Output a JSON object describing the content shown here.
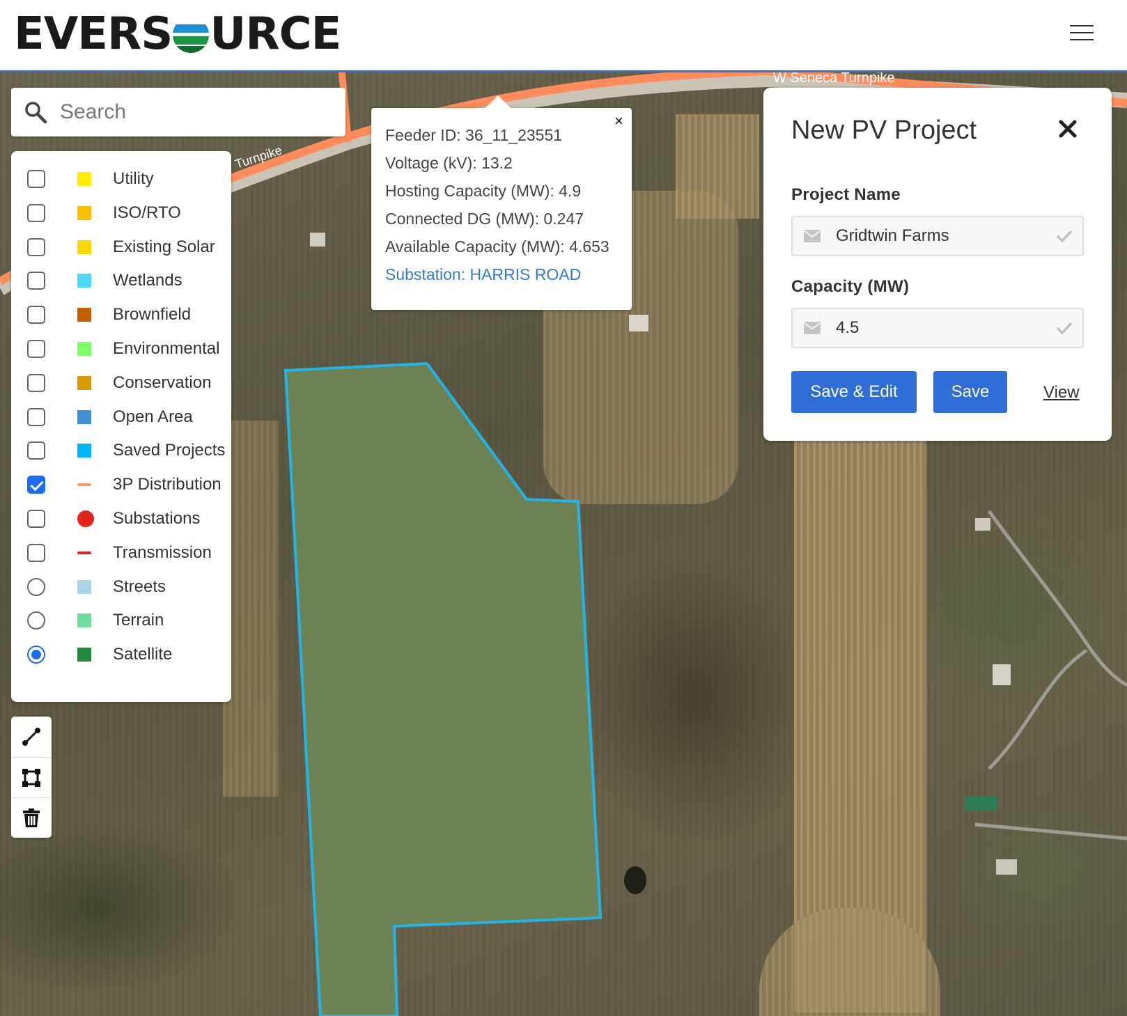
{
  "header": {
    "logo_left": "EVERS",
    "logo_right": "URCE",
    "menu_icon": "hamburger-menu-icon"
  },
  "search": {
    "placeholder": "Search",
    "icon": "search-icon"
  },
  "legend": {
    "items": [
      {
        "label": "Utility",
        "control": "checkbox",
        "checked": false,
        "color": "#ffee00",
        "swatch": "square"
      },
      {
        "label": "ISO/RTO",
        "control": "checkbox",
        "checked": false,
        "color": "#ffbe00",
        "swatch": "square"
      },
      {
        "label": "Existing Solar",
        "control": "checkbox",
        "checked": false,
        "color": "#ffd700",
        "swatch": "square"
      },
      {
        "label": "Wetlands",
        "control": "checkbox",
        "checked": false,
        "color": "#4dd8f7",
        "swatch": "square"
      },
      {
        "label": "Brownfield",
        "control": "checkbox",
        "checked": false,
        "color": "#c45e00",
        "swatch": "square"
      },
      {
        "label": "Environmental",
        "control": "checkbox",
        "checked": false,
        "color": "#7dff6a",
        "swatch": "square"
      },
      {
        "label": "Conservation",
        "control": "checkbox",
        "checked": false,
        "color": "#d69a00",
        "swatch": "square"
      },
      {
        "label": "Open Area",
        "control": "checkbox",
        "checked": false,
        "color": "#3f8fd4",
        "swatch": "square"
      },
      {
        "label": "Saved Projects",
        "control": "checkbox",
        "checked": false,
        "color": "#00b4f5",
        "swatch": "square"
      },
      {
        "label": "3P Distribution",
        "control": "checkbox",
        "checked": true,
        "color": "#ff9a66",
        "swatch": "line"
      },
      {
        "label": "Substations",
        "control": "checkbox",
        "checked": false,
        "color": "#e2261b",
        "swatch": "dot"
      },
      {
        "label": "Transmission",
        "control": "checkbox",
        "checked": false,
        "color": "#e0202a",
        "swatch": "line"
      },
      {
        "label": "Streets",
        "control": "radio",
        "checked": false,
        "color": "#a9d4e5",
        "swatch": "square"
      },
      {
        "label": "Terrain",
        "control": "radio",
        "checked": false,
        "color": "#6fdb9c",
        "swatch": "square"
      },
      {
        "label": "Satellite",
        "control": "radio",
        "checked": true,
        "color": "#248a3d",
        "swatch": "square"
      }
    ]
  },
  "tools": [
    {
      "name": "draw-line-tool",
      "icon": "line-tool-icon"
    },
    {
      "name": "draw-polygon-tool",
      "icon": "polygon-tool-icon"
    },
    {
      "name": "delete-tool",
      "icon": "trash-icon"
    }
  ],
  "popup": {
    "close": "×",
    "feeder": "Feeder ID: 36_11_23551",
    "voltage": "Voltage (kV): 13.2",
    "hosting": "Hosting Capacity (MW): 4.9",
    "connected": "Connected DG (MW): 0.247",
    "available": "Available Capacity (MW): 4.653",
    "substation": "Substation: HARRIS ROAD"
  },
  "panel": {
    "title": "New PV Project",
    "project_name_label": "Project Name",
    "project_name_value": "Gridtwin Farms",
    "capacity_label": "Capacity (MW)",
    "capacity_value": "4.5",
    "save_edit": "Save & Edit",
    "save": "Save",
    "view": "View"
  },
  "map": {
    "road_label": "W Seneca Turnpike",
    "road_label_left": "Turnpike",
    "distribution_color": "#ff8c5a",
    "selection_color": "#22b3e8"
  }
}
